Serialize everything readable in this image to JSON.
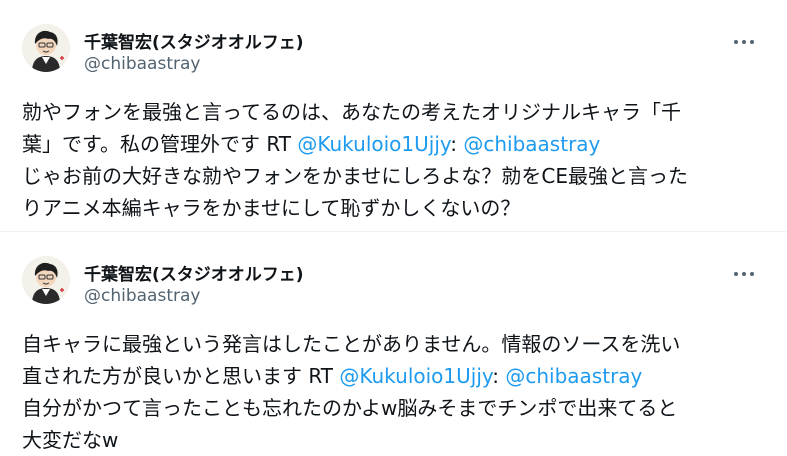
{
  "tweets": [
    {
      "author_name": "千葉智宏(スタジオオルフェ)",
      "author_handle": "@chibaastray",
      "lines": [
        "勍やフォンを最強と言ってるのは、あなたの考えたオリジナルキャラ「千",
        "葉」です。私の管理外です"
      ],
      "rt_prefix": "RT ",
      "rt_mention": "@Kukuloio1Ujjy",
      "rt_colon": ": ",
      "reply_mention": "@chibaastray",
      "quoted_lines": [
        "じゃお前の大好きな勍やフォンをかませにしろよな？勍をCE最強と言った",
        "りアニメ本編キャラをかませにして恥ずかしくないの？"
      ]
    },
    {
      "author_name": "千葉智宏(スタジオオルフェ)",
      "author_handle": "@chibaastray",
      "lines": [
        "自キャラに最強という発言はしたことがありません。情報のソースを洗い",
        "直された方が良いかと思います"
      ],
      "rt_prefix": "RT ",
      "rt_mention": "@Kukuloio1Ujjy",
      "rt_colon": ": ",
      "reply_mention": "@chibaastray",
      "quoted_lines": [
        "自分がかつて言ったことも忘れたのかよw脳みそまでチンポで出来てると",
        "大変だなw"
      ]
    }
  ],
  "colors": {
    "link": "#1d9bf0",
    "text": "#0f1419",
    "secondary": "#536471"
  },
  "icons": {
    "more": "more-horizontal-icon"
  }
}
